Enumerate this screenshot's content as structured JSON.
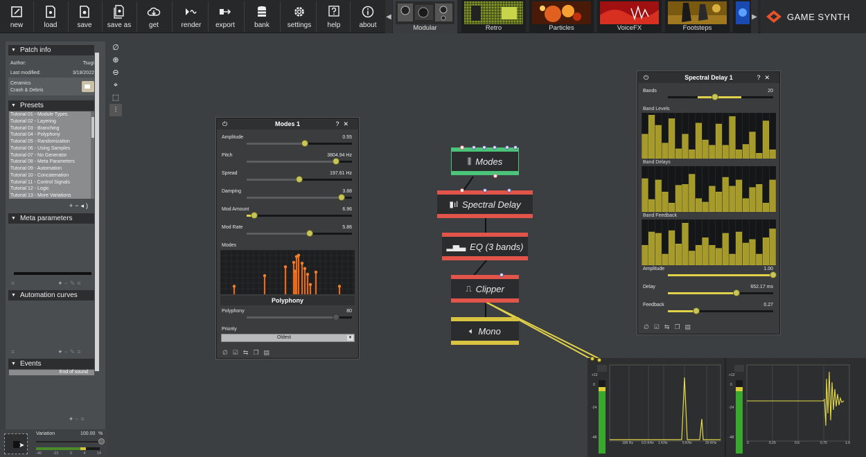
{
  "toolbar": {
    "buttons": [
      {
        "label": "new",
        "icon": "new-icon"
      },
      {
        "label": "load",
        "icon": "load-icon"
      },
      {
        "label": "save",
        "icon": "save-icon"
      },
      {
        "label": "save as",
        "icon": "save-as-icon"
      },
      {
        "label": "get",
        "icon": "cloud-get-icon"
      },
      {
        "label": "render",
        "icon": "render-icon"
      },
      {
        "label": "export",
        "icon": "export-icon"
      },
      {
        "label": "bank",
        "icon": "bank-icon"
      },
      {
        "label": "settings",
        "icon": "gear-icon"
      },
      {
        "label": "help",
        "icon": "help-icon"
      },
      {
        "label": "about",
        "icon": "info-icon"
      }
    ],
    "tabs": [
      {
        "label": "Modular",
        "active": true
      },
      {
        "label": "Retro"
      },
      {
        "label": "Particles"
      },
      {
        "label": "VoiceFX"
      },
      {
        "label": "Footsteps"
      }
    ],
    "brand": "GAME SYNTH"
  },
  "left_panel": {
    "patch_info": {
      "header": "Patch info",
      "author_label": "Author:",
      "author": "Tsugi",
      "modified_label": "Last modified:",
      "modified": "3/18/2022",
      "tags_line1": "Ceramics",
      "tags_line2": "Crash & Debris"
    },
    "presets": {
      "header": "Presets",
      "items": [
        "Tutorial 01 - Module Types",
        "Tutorial 02 - Layering",
        "Tutorial 03 - Branching",
        "Tutorial 04 - Polyphony",
        "Tutorial 05 - Randomization",
        "Tutorial 06 - Using Samples",
        "Tutorial 07 - No Generator",
        "Tutorial 08 - Meta Parameters",
        "Tutorial 09 - Automation",
        "Tutorial 10 - Concatenation",
        "Tutorial 11 - Control Signals",
        "Tutorial 12 - Logic",
        "Tutorial 13 - More Variations"
      ]
    },
    "meta_parameters": {
      "header": "Meta parameters"
    },
    "automation_curves": {
      "header": "Automation curves"
    },
    "events": {
      "header": "Events",
      "item": "End of sound"
    },
    "variation": {
      "label": "Variation",
      "value": "100.00",
      "unit": "%",
      "scale": [
        "-46",
        "-23",
        "0",
        "4",
        "14"
      ]
    }
  },
  "modes_window": {
    "title": "Modes 1",
    "params": [
      {
        "name": "Amplitude",
        "value": "0.55",
        "level": 0.55
      },
      {
        "name": "Pitch",
        "value": "3804.94 Hz",
        "level": 0.85
      },
      {
        "name": "Spread",
        "value": "197.61 Hz",
        "level": 0.5
      },
      {
        "name": "Damping",
        "value": "3.88",
        "level": 0.9
      },
      {
        "name": "Mod Amount",
        "value": "6.96",
        "level": 0.07
      },
      {
        "name": "Mod Rate",
        "value": "5.86",
        "level": 0.6
      }
    ],
    "modes_label": "Modes",
    "modes_bars": [
      0.18,
      0.42,
      0.62,
      0.72,
      0.52,
      0.85,
      0.88,
      0.7,
      0.58,
      0.45,
      0.22,
      0.5,
      0.18
    ],
    "polyphony_header": "Polyphony",
    "polyphony": {
      "name": "Polyphony",
      "value": "80",
      "level": 0.85
    },
    "priority_label": "Priority",
    "priority_value": "Oldest"
  },
  "graph": {
    "nodes": [
      {
        "name": "Modes",
        "color": "#4cc47a"
      },
      {
        "name": "Spectral Delay",
        "color": "#e0544a"
      },
      {
        "name": "EQ (3 bands)",
        "color": "#e0544a"
      },
      {
        "name": "Clipper",
        "color": "#e0544a"
      },
      {
        "name": "Mono",
        "color": "#d8c440"
      }
    ]
  },
  "spectral_delay_window": {
    "title": "Spectral Delay 1",
    "bands_label": "Bands",
    "bands_value": "20",
    "bands_level": 0.7,
    "band_levels_label": "Band Levels",
    "band_levels": [
      0.55,
      0.98,
      0.75,
      0.35,
      0.9,
      0.22,
      0.55,
      0.2,
      0.8,
      0.42,
      0.3,
      0.78,
      0.3,
      0.95,
      0.2,
      0.32,
      0.6,
      0.12,
      0.85,
      0.2
    ],
    "band_delays_label": "Band Delays",
    "band_delays": [
      0.75,
      0.28,
      0.72,
      0.45,
      0.2,
      0.6,
      0.62,
      0.85,
      0.3,
      0.22,
      0.58,
      0.45,
      0.78,
      0.58,
      0.72,
      0.3,
      0.55,
      0.62,
      0.2,
      0.72
    ],
    "band_feedback_label": "Band Feedback",
    "band_feedback": [
      0.45,
      0.75,
      0.72,
      0.25,
      0.78,
      0.48,
      0.95,
      0.32,
      0.45,
      0.62,
      0.45,
      0.38,
      0.72,
      0.25,
      0.75,
      0.5,
      0.58,
      0.25,
      0.62,
      0.82
    ],
    "params": [
      {
        "name": "Amplitude",
        "value": "1.00",
        "level": 1.0
      },
      {
        "name": "Delay",
        "value": "652.17 ms",
        "level": 0.65
      },
      {
        "name": "Feedback",
        "value": "0.27",
        "level": 0.27
      }
    ]
  },
  "scopes": {
    "meter_labels": [
      "+12",
      "0",
      "-24",
      "-48"
    ],
    "spectrum_ticks": [
      "100 Hz",
      "0.5 KHz",
      "1 KHz",
      "5 KHz",
      "20 KHz"
    ],
    "time_ticks": [
      "0",
      "0.25",
      "0.5",
      "0.75",
      "1.0"
    ],
    "label_x": "x"
  }
}
